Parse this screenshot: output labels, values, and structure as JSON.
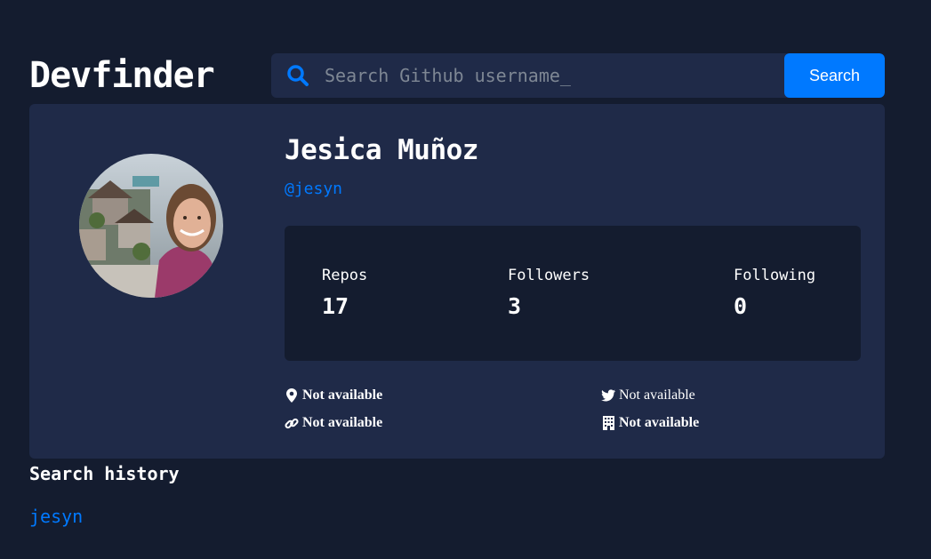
{
  "header": {
    "logo": "Devfinder"
  },
  "search": {
    "placeholder": "Search Github username_",
    "value": "",
    "button_label": "Search"
  },
  "profile": {
    "name": "Jesica Muñoz",
    "login": "@jesyn",
    "stats": [
      {
        "label": "Repos",
        "value": "17"
      },
      {
        "label": "Followers",
        "value": "3"
      },
      {
        "label": "Following",
        "value": "0"
      }
    ],
    "links": {
      "location": "Not available",
      "twitter": "Not available",
      "website": "Not available",
      "company": "Not available"
    }
  },
  "history": {
    "title": "Search history",
    "items": [
      "jesyn"
    ]
  },
  "colors": {
    "background": "#141c2f",
    "card": "#1f2a48",
    "accent": "#0079ff",
    "text": "#ffffff"
  },
  "icons": [
    "search-icon",
    "location-pin-icon",
    "twitter-icon",
    "link-icon",
    "building-icon"
  ]
}
